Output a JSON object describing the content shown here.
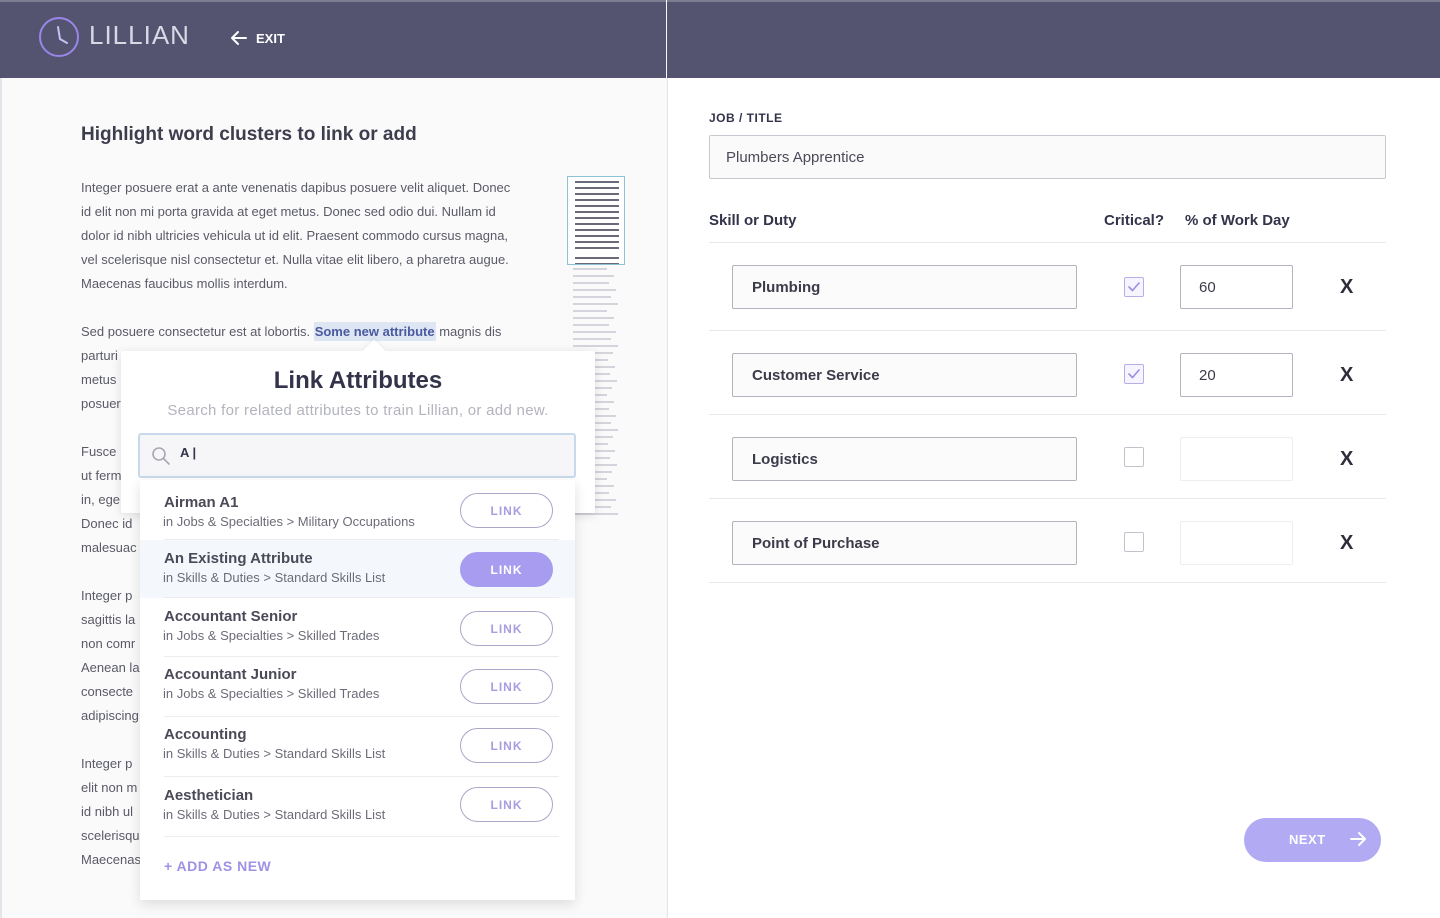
{
  "header": {
    "logo_text": "LILLIAN",
    "exit_label": "EXIT"
  },
  "document": {
    "heading": "Highlight word clusters to link or add",
    "para1": [
      "Integer posuere erat a ante venenatis dapibus posuere velit aliquet. Donec",
      "id elit non mi porta gravida at eget metus. Donec sed odio dui. Nullam id",
      "dolor id nibh ultricies vehicula ut id elit. Praesent commodo cursus magna,",
      "vel scelerisque nisl consectetur et.  Nulla vitae elit libero, a pharetra augue.",
      "Maecenas faucibus mollis interdum."
    ],
    "para2_before": "Sed posuere consectetur est at lobortis. ",
    "para2_highlight": "Some new attribute",
    "para2_after": " magnis dis",
    "para2_rest": [
      "parturi",
      "metus",
      "posuer"
    ],
    "para3": [
      "Fusce",
      "ut ferm",
      "in, ege",
      "Donec id",
      "malesuac"
    ],
    "para4": [
      "Integer p",
      "sagittis la",
      "non comr",
      "Aenean la",
      "consecte",
      "adipiscing"
    ],
    "para5": [
      "Integer p",
      "elit non m",
      "id nibh ul",
      "scelerisqu",
      "Maecenas"
    ]
  },
  "popover": {
    "title": "Link Attributes",
    "subtitle": "Search for related attributes to train Lillian, or add new.",
    "search_value": "A |",
    "items": [
      {
        "name": "Airman A1",
        "path": "in Jobs & Specialties > Military Occupations",
        "link_label": "LINK"
      },
      {
        "name": "An Existing Attribute",
        "path": "in Skills & Duties > Standard Skills List",
        "link_label": "LINK"
      },
      {
        "name": "Accountant Senior",
        "path": "in Jobs & Specialties > Skilled Trades",
        "link_label": "LINK"
      },
      {
        "name": "Accountant Junior",
        "path": "in Jobs & Specialties > Skilled Trades",
        "link_label": "LINK"
      },
      {
        "name": "Accounting",
        "path": "in Skills & Duties > Standard Skills List",
        "link_label": "LINK"
      },
      {
        "name": "Aesthetician",
        "path": "in Skills & Duties > Standard Skills List",
        "link_label": "LINK"
      }
    ],
    "add_new_label": "+ ADD AS NEW"
  },
  "form": {
    "job_label": "JOB / TITLE",
    "job_value": "Plumbers Apprentice",
    "col_skill": "Skill  or Duty",
    "col_critical": "Critical?",
    "col_pct": "% of Work Day",
    "rows": [
      {
        "skill": "Plumbing",
        "critical": true,
        "pct": "60",
        "remove": "X"
      },
      {
        "skill": "Customer Service",
        "critical": true,
        "pct": "20",
        "remove": "X"
      },
      {
        "skill": "Logistics",
        "critical": false,
        "pct": "",
        "remove": "X"
      },
      {
        "skill": "Point of Purchase",
        "critical": false,
        "pct": "",
        "remove": "X"
      }
    ],
    "next_label": "NEXT"
  },
  "colors": {
    "header_bg": "#545470",
    "accent": "#a89cf0",
    "highlight_bg": "#dde6f2"
  }
}
